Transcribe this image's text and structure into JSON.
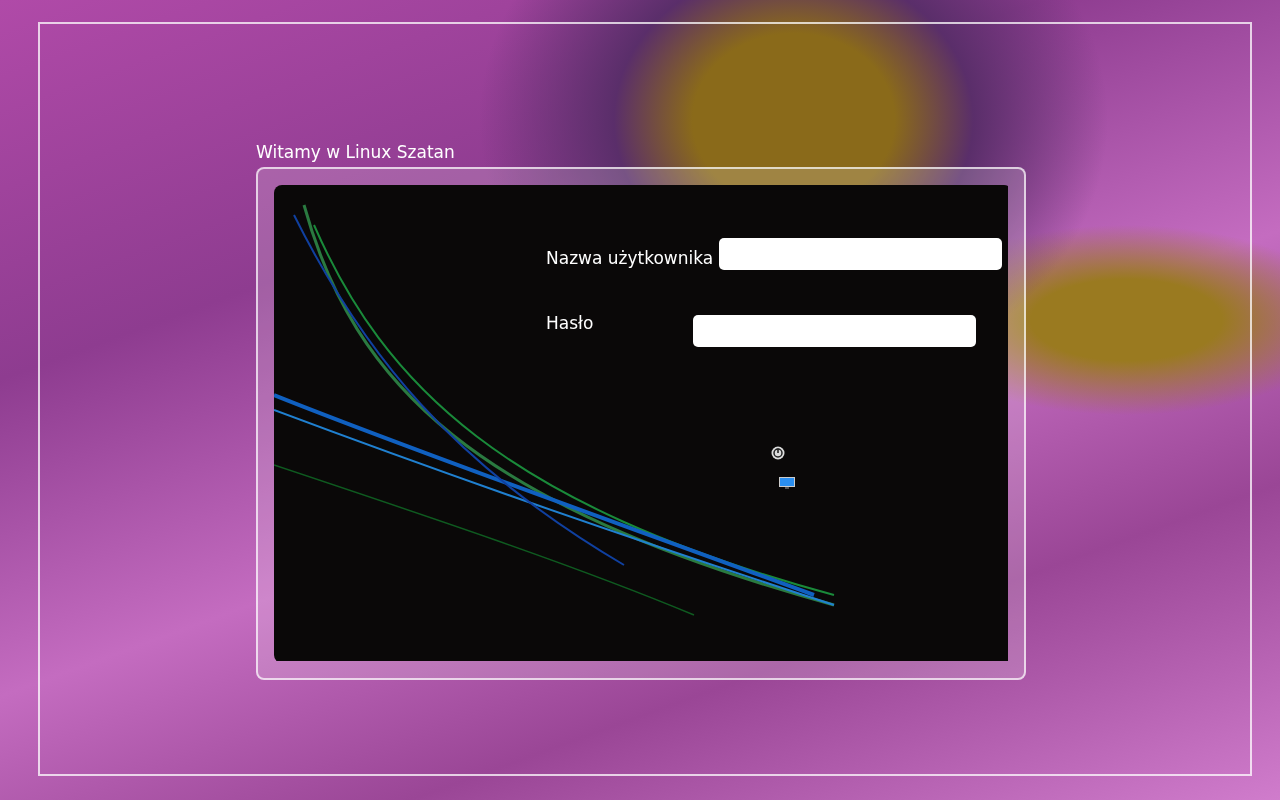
{
  "greeting": "Witamy w Linux Szatan",
  "fields": [
    {
      "label": "Nazwa użytkownika",
      "kind": "text"
    },
    {
      "label": "Hasło",
      "kind": "password"
    }
  ]
}
